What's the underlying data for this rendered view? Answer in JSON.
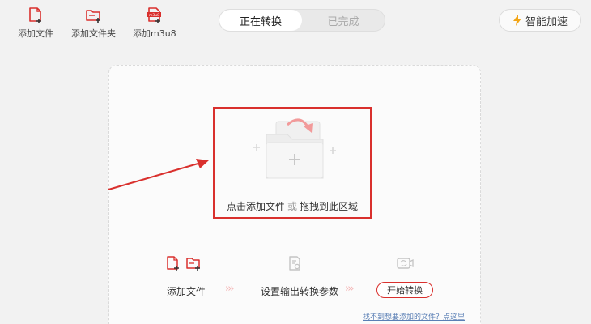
{
  "toolbar": {
    "add_file": "添加文件",
    "add_folder": "添加文件夹",
    "add_m3u8": "添加m3u8",
    "m3u8_badge": "m3u8"
  },
  "tabs": {
    "converting": "正在转换",
    "completed": "已完成"
  },
  "accelerate": "智能加速",
  "drop_zone": {
    "part1": "点击添加文件",
    "or": "或",
    "part2": "拖拽到此区域"
  },
  "steps": {
    "add_file": "添加文件",
    "set_params": "设置输出转换参数",
    "start": "开始转换"
  },
  "help_link": "找不到想要添加的文件？点这里",
  "colors": {
    "accent": "#d9302d",
    "background": "#f2f2f2",
    "link": "#5a7fb5"
  }
}
